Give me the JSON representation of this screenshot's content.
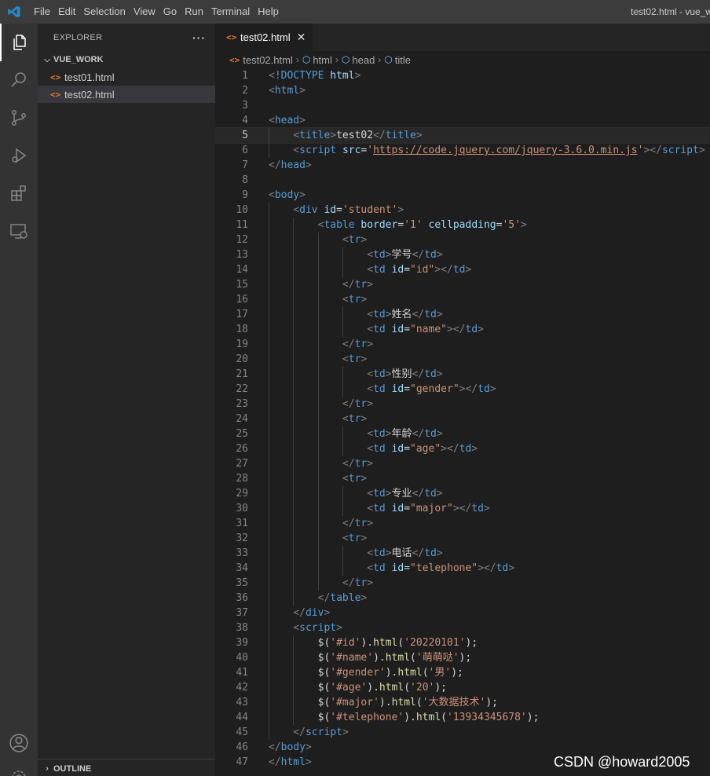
{
  "titlebar": {
    "menu": [
      "File",
      "Edit",
      "Selection",
      "View",
      "Go",
      "Run",
      "Terminal",
      "Help"
    ],
    "window_title": "test02.html - vue_w"
  },
  "activity_icons": [
    "explorer-icon",
    "search-icon",
    "source-control-icon",
    "run-debug-icon",
    "extensions-icon",
    "remote-explorer-icon",
    "account-icon",
    "settings-icon"
  ],
  "sidebar": {
    "title": "EXPLORER",
    "more": "···",
    "folder": "VUE_WORK",
    "files": [
      "test01.html",
      "test02.html"
    ],
    "selected_file": "test02.html",
    "outline": "OUTLINE"
  },
  "tab": {
    "label": "test02.html",
    "close": "✕"
  },
  "breadcrumb": [
    "test02.html",
    "html",
    "head",
    "title"
  ],
  "editor": {
    "current_line": 5,
    "lines": [
      [
        [
          "pun",
          "<"
        ],
        [
          "tag",
          "!DOCTYPE "
        ],
        [
          "att",
          "html"
        ],
        [
          "pun",
          ">"
        ]
      ],
      [
        [
          "pun",
          "<"
        ],
        [
          "tag",
          "html"
        ],
        [
          "pun",
          ">"
        ]
      ],
      [],
      [
        [
          "pun",
          "<"
        ],
        [
          "tag",
          "head"
        ],
        [
          "pun",
          ">"
        ]
      ],
      [
        [
          "pun",
          "    <"
        ],
        [
          "tag",
          "title"
        ],
        [
          "pun",
          ">"
        ],
        [
          "txt",
          "test02"
        ],
        [
          "pun",
          "</"
        ],
        [
          "tag",
          "title"
        ],
        [
          "pun",
          ">"
        ]
      ],
      [
        [
          "pun",
          "    <"
        ],
        [
          "tag",
          "script "
        ],
        [
          "att",
          "src"
        ],
        [
          "txt",
          "="
        ],
        [
          "str",
          "'"
        ],
        [
          "strul",
          "https://code.jquery.com/jquery-3.6.0.min.js"
        ],
        [
          "str",
          "'"
        ],
        [
          "pun",
          "></"
        ],
        [
          "tag",
          "script"
        ],
        [
          "pun",
          ">"
        ]
      ],
      [
        [
          "pun",
          "</"
        ],
        [
          "tag",
          "head"
        ],
        [
          "pun",
          ">"
        ]
      ],
      [],
      [
        [
          "pun",
          "<"
        ],
        [
          "tag",
          "body"
        ],
        [
          "pun",
          ">"
        ]
      ],
      [
        [
          "pun",
          "    <"
        ],
        [
          "tag",
          "div "
        ],
        [
          "att",
          "id"
        ],
        [
          "txt",
          "="
        ],
        [
          "str",
          "'student'"
        ],
        [
          "pun",
          ">"
        ]
      ],
      [
        [
          "pun",
          "        <"
        ],
        [
          "tag",
          "table "
        ],
        [
          "att",
          "border"
        ],
        [
          "txt",
          "="
        ],
        [
          "str",
          "'1' "
        ],
        [
          "att",
          "cellpadding"
        ],
        [
          "txt",
          "="
        ],
        [
          "str",
          "'5'"
        ],
        [
          "pun",
          ">"
        ]
      ],
      [
        [
          "pun",
          "            <"
        ],
        [
          "tag",
          "tr"
        ],
        [
          "pun",
          ">"
        ]
      ],
      [
        [
          "pun",
          "                <"
        ],
        [
          "tag",
          "td"
        ],
        [
          "pun",
          ">"
        ],
        [
          "txt",
          "学号"
        ],
        [
          "pun",
          "</"
        ],
        [
          "tag",
          "td"
        ],
        [
          "pun",
          ">"
        ]
      ],
      [
        [
          "pun",
          "                <"
        ],
        [
          "tag",
          "td "
        ],
        [
          "att",
          "id"
        ],
        [
          "txt",
          "="
        ],
        [
          "str",
          "\"id\""
        ],
        [
          "pun",
          "></"
        ],
        [
          "tag",
          "td"
        ],
        [
          "pun",
          ">"
        ]
      ],
      [
        [
          "pun",
          "            </"
        ],
        [
          "tag",
          "tr"
        ],
        [
          "pun",
          ">"
        ]
      ],
      [
        [
          "pun",
          "            <"
        ],
        [
          "tag",
          "tr"
        ],
        [
          "pun",
          ">"
        ]
      ],
      [
        [
          "pun",
          "                <"
        ],
        [
          "tag",
          "td"
        ],
        [
          "pun",
          ">"
        ],
        [
          "txt",
          "姓名"
        ],
        [
          "pun",
          "</"
        ],
        [
          "tag",
          "td"
        ],
        [
          "pun",
          ">"
        ]
      ],
      [
        [
          "pun",
          "                <"
        ],
        [
          "tag",
          "td "
        ],
        [
          "att",
          "id"
        ],
        [
          "txt",
          "="
        ],
        [
          "str",
          "\"name\""
        ],
        [
          "pun",
          "></"
        ],
        [
          "tag",
          "td"
        ],
        [
          "pun",
          ">"
        ]
      ],
      [
        [
          "pun",
          "            </"
        ],
        [
          "tag",
          "tr"
        ],
        [
          "pun",
          ">"
        ]
      ],
      [
        [
          "pun",
          "            <"
        ],
        [
          "tag",
          "tr"
        ],
        [
          "pun",
          ">"
        ]
      ],
      [
        [
          "pun",
          "                <"
        ],
        [
          "tag",
          "td"
        ],
        [
          "pun",
          ">"
        ],
        [
          "txt",
          "性别"
        ],
        [
          "pun",
          "</"
        ],
        [
          "tag",
          "td"
        ],
        [
          "pun",
          ">"
        ]
      ],
      [
        [
          "pun",
          "                <"
        ],
        [
          "tag",
          "td "
        ],
        [
          "att",
          "id"
        ],
        [
          "txt",
          "="
        ],
        [
          "str",
          "\"gender\""
        ],
        [
          "pun",
          "></"
        ],
        [
          "tag",
          "td"
        ],
        [
          "pun",
          ">"
        ]
      ],
      [
        [
          "pun",
          "            </"
        ],
        [
          "tag",
          "tr"
        ],
        [
          "pun",
          ">"
        ]
      ],
      [
        [
          "pun",
          "            <"
        ],
        [
          "tag",
          "tr"
        ],
        [
          "pun",
          ">"
        ]
      ],
      [
        [
          "pun",
          "                <"
        ],
        [
          "tag",
          "td"
        ],
        [
          "pun",
          ">"
        ],
        [
          "txt",
          "年龄"
        ],
        [
          "pun",
          "</"
        ],
        [
          "tag",
          "td"
        ],
        [
          "pun",
          ">"
        ]
      ],
      [
        [
          "pun",
          "                <"
        ],
        [
          "tag",
          "td "
        ],
        [
          "att",
          "id"
        ],
        [
          "txt",
          "="
        ],
        [
          "str",
          "\"age\""
        ],
        [
          "pun",
          "></"
        ],
        [
          "tag",
          "td"
        ],
        [
          "pun",
          ">"
        ]
      ],
      [
        [
          "pun",
          "            </"
        ],
        [
          "tag",
          "tr"
        ],
        [
          "pun",
          ">"
        ]
      ],
      [
        [
          "pun",
          "            <"
        ],
        [
          "tag",
          "tr"
        ],
        [
          "pun",
          ">"
        ]
      ],
      [
        [
          "pun",
          "                <"
        ],
        [
          "tag",
          "td"
        ],
        [
          "pun",
          ">"
        ],
        [
          "txt",
          "专业"
        ],
        [
          "pun",
          "</"
        ],
        [
          "tag",
          "td"
        ],
        [
          "pun",
          ">"
        ]
      ],
      [
        [
          "pun",
          "                <"
        ],
        [
          "tag",
          "td "
        ],
        [
          "att",
          "id"
        ],
        [
          "txt",
          "="
        ],
        [
          "str",
          "\"major\""
        ],
        [
          "pun",
          "></"
        ],
        [
          "tag",
          "td"
        ],
        [
          "pun",
          ">"
        ]
      ],
      [
        [
          "pun",
          "            </"
        ],
        [
          "tag",
          "tr"
        ],
        [
          "pun",
          ">"
        ]
      ],
      [
        [
          "pun",
          "            <"
        ],
        [
          "tag",
          "tr"
        ],
        [
          "pun",
          ">"
        ]
      ],
      [
        [
          "pun",
          "                <"
        ],
        [
          "tag",
          "td"
        ],
        [
          "pun",
          ">"
        ],
        [
          "txt",
          "电话"
        ],
        [
          "pun",
          "</"
        ],
        [
          "tag",
          "td"
        ],
        [
          "pun",
          ">"
        ]
      ],
      [
        [
          "pun",
          "                <"
        ],
        [
          "tag",
          "td "
        ],
        [
          "att",
          "id"
        ],
        [
          "txt",
          "="
        ],
        [
          "str",
          "\"telephone\""
        ],
        [
          "pun",
          "></"
        ],
        [
          "tag",
          "td"
        ],
        [
          "pun",
          ">"
        ]
      ],
      [
        [
          "pun",
          "            </"
        ],
        [
          "tag",
          "tr"
        ],
        [
          "pun",
          ">"
        ]
      ],
      [
        [
          "pun",
          "        </"
        ],
        [
          "tag",
          "table"
        ],
        [
          "pun",
          ">"
        ]
      ],
      [
        [
          "pun",
          "    </"
        ],
        [
          "tag",
          "div"
        ],
        [
          "pun",
          ">"
        ]
      ],
      [
        [
          "pun",
          "    <"
        ],
        [
          "tag",
          "script"
        ],
        [
          "pun",
          ">"
        ]
      ],
      [
        [
          "txt",
          "        $("
        ],
        [
          "str",
          "'#id'"
        ],
        [
          "txt",
          ")."
        ],
        [
          "fn",
          "html"
        ],
        [
          "txt",
          "("
        ],
        [
          "str",
          "'20220101'"
        ],
        [
          "txt",
          ");"
        ]
      ],
      [
        [
          "txt",
          "        $("
        ],
        [
          "str",
          "'#name'"
        ],
        [
          "txt",
          ")."
        ],
        [
          "fn",
          "html"
        ],
        [
          "txt",
          "("
        ],
        [
          "str",
          "'萌萌哒'"
        ],
        [
          "txt",
          ");"
        ]
      ],
      [
        [
          "txt",
          "        $("
        ],
        [
          "str",
          "'#gender'"
        ],
        [
          "txt",
          ")."
        ],
        [
          "fn",
          "html"
        ],
        [
          "txt",
          "("
        ],
        [
          "str",
          "'男'"
        ],
        [
          "txt",
          ");"
        ]
      ],
      [
        [
          "txt",
          "        $("
        ],
        [
          "str",
          "'#age'"
        ],
        [
          "txt",
          ")."
        ],
        [
          "fn",
          "html"
        ],
        [
          "txt",
          "("
        ],
        [
          "str",
          "'20'"
        ],
        [
          "txt",
          ");"
        ]
      ],
      [
        [
          "txt",
          "        $("
        ],
        [
          "str",
          "'#major'"
        ],
        [
          "txt",
          ")."
        ],
        [
          "fn",
          "html"
        ],
        [
          "txt",
          "("
        ],
        [
          "str",
          "'大数据技术'"
        ],
        [
          "txt",
          ");"
        ]
      ],
      [
        [
          "txt",
          "        $("
        ],
        [
          "str",
          "'#telephone'"
        ],
        [
          "txt",
          ")."
        ],
        [
          "fn",
          "html"
        ],
        [
          "txt",
          "("
        ],
        [
          "str",
          "'13934345678'"
        ],
        [
          "txt",
          ");"
        ]
      ],
      [
        [
          "pun",
          "    </"
        ],
        [
          "tag",
          "script"
        ],
        [
          "pun",
          ">"
        ]
      ],
      [
        [
          "pun",
          "</"
        ],
        [
          "tag",
          "body"
        ],
        [
          "pun",
          ">"
        ]
      ],
      [
        [
          "pun",
          "</"
        ],
        [
          "tag",
          "html"
        ],
        [
          "pun",
          ">"
        ]
      ]
    ]
  },
  "watermark": "CSDN @howard2005",
  "colors": {
    "accent_file_icon": "#e37933",
    "tag": "#569cd6",
    "attr": "#9cdcfe",
    "string": "#ce9178"
  }
}
